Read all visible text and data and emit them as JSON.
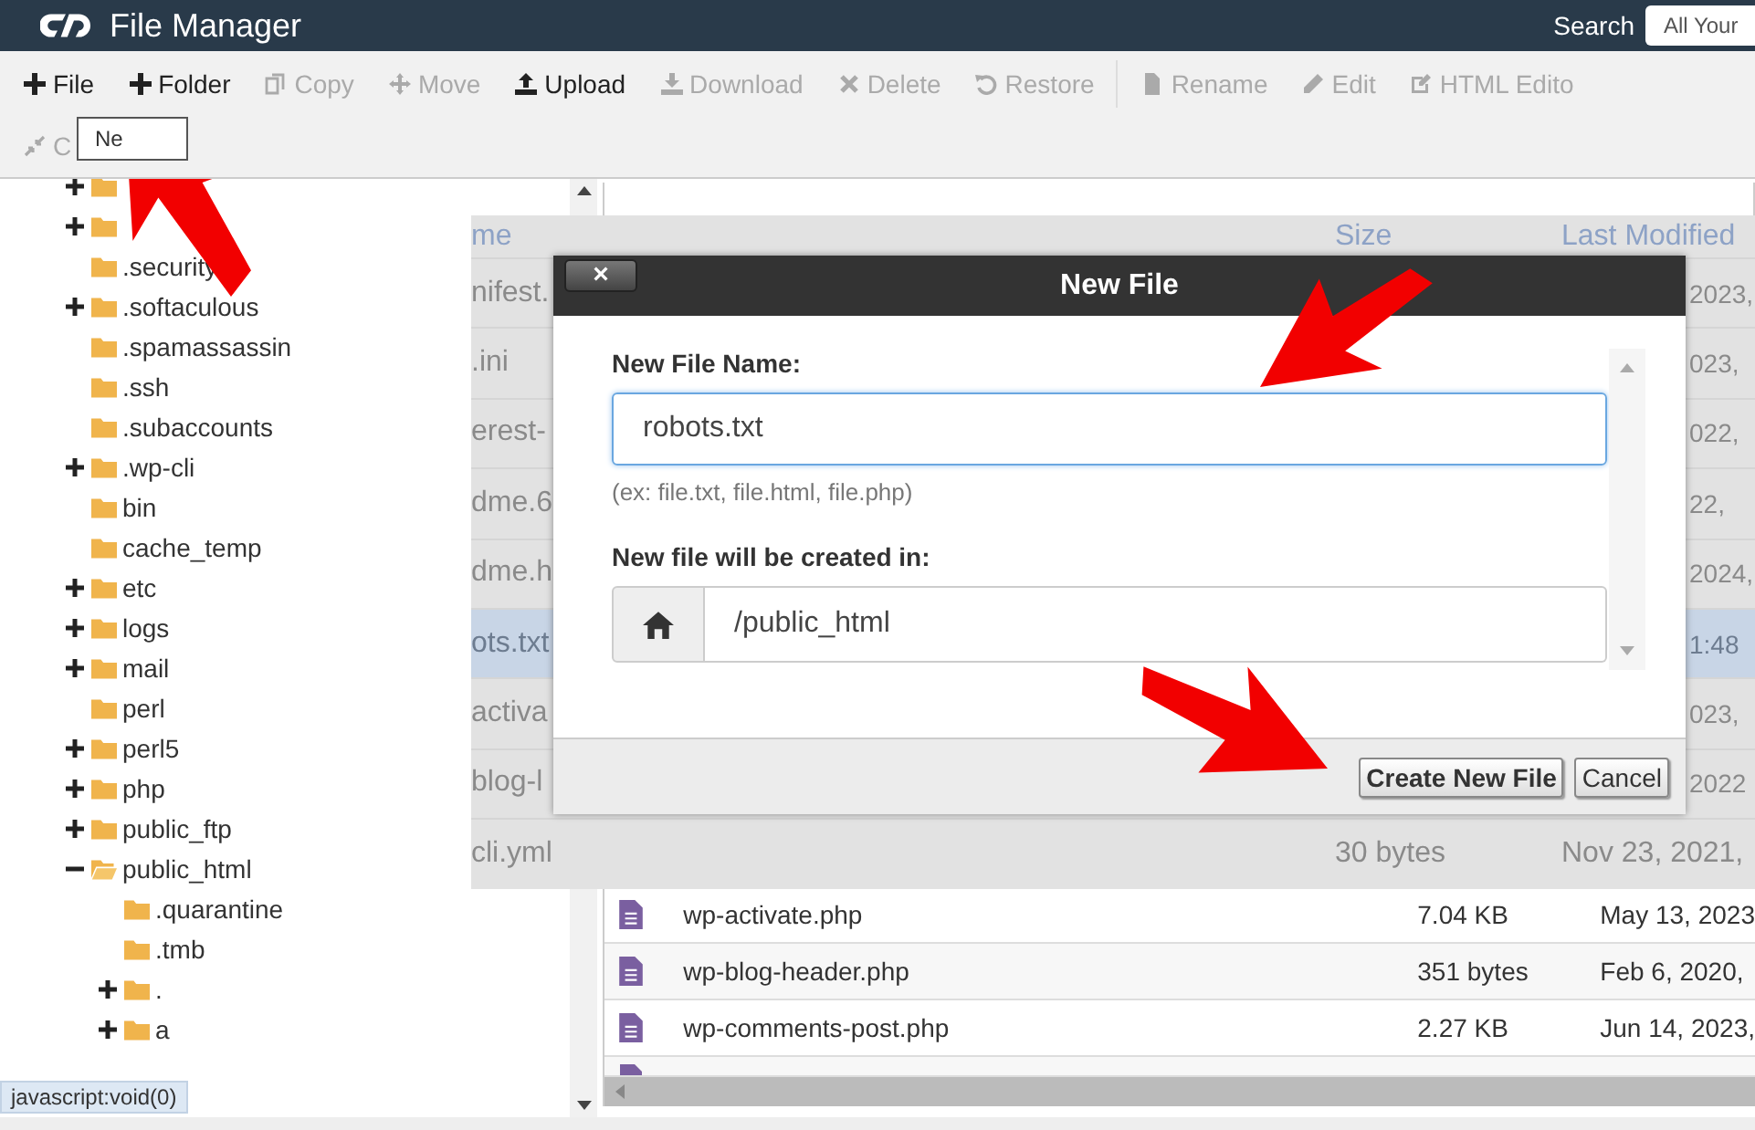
{
  "header": {
    "title": "File Manager",
    "search_label": "Search",
    "search_value": "All Your"
  },
  "toolbar": [
    {
      "label": "File",
      "disabled": false
    },
    {
      "label": "Folder",
      "disabled": false
    },
    {
      "label": "Copy",
      "disabled": true
    },
    {
      "label": "Move",
      "disabled": true
    },
    {
      "label": "Upload",
      "disabled": false
    },
    {
      "label": "Download",
      "disabled": true
    },
    {
      "label": "Delete",
      "disabled": true
    },
    {
      "label": "Restore",
      "disabled": true
    },
    {
      "label": "Rename",
      "disabled": true
    },
    {
      "label": "Edit",
      "disabled": true
    },
    {
      "label": "HTML Edito",
      "disabled": true
    }
  ],
  "toolbar_row2": [
    {
      "label": "C",
      "disabled": true
    }
  ],
  "tooltip": "Ne",
  "tree": [
    {
      "expanded": false
    },
    {
      "expanded": false
    },
    {
      "label": ".security"
    },
    {
      "label": ".softaculous",
      "expanded": false
    },
    {
      "label": ".spamassassin"
    },
    {
      "label": ".ssh"
    },
    {
      "label": ".subaccounts"
    },
    {
      "label": ".wp-cli",
      "expanded": false
    },
    {
      "label": "bin"
    },
    {
      "label": "cache_temp"
    },
    {
      "label": "etc",
      "expanded": false
    },
    {
      "label": "logs",
      "expanded": false
    },
    {
      "label": "mail",
      "expanded": false
    },
    {
      "label": "perl"
    },
    {
      "label": "perl5",
      "expanded": false
    },
    {
      "label": "php",
      "expanded": false
    },
    {
      "label": "public_ftp",
      "expanded": false
    },
    {
      "label": "public_html",
      "expanded": true,
      "children": [
        {
          "label": ".quarantine"
        },
        {
          "label": ".tmb"
        },
        {
          "label": ".",
          "expanded": false
        },
        {
          "label": "a",
          "expanded": false
        }
      ]
    }
  ],
  "status_link": "javascript:void(0)",
  "backdrop": {
    "columns": [
      "me",
      "Size",
      "Last Modified"
    ],
    "rows": [
      {
        "name": "nifest.",
        "date": "2023,",
        "selected": false
      },
      {
        "name": ".ini",
        "date": "023,",
        "selected": false
      },
      {
        "name": "erest-",
        "date": "022,",
        "selected": false
      },
      {
        "name": "dme.6",
        "date": "22,",
        "selected": false
      },
      {
        "name": "dme.h",
        "date": "2024,",
        "selected": false
      },
      {
        "name": "ots.txt",
        "date": "1:48",
        "selected": true
      },
      {
        "name": "activa",
        "date": "023,",
        "selected": false
      },
      {
        "name": "blog-l",
        "date": "2022",
        "selected": false
      },
      {
        "name": "cli.yml",
        "size": "30 bytes",
        "date": "Nov 23, 2021,",
        "selected": false
      }
    ]
  },
  "files": [
    {
      "name": "wp-activate.php",
      "size": "7.04 KB",
      "date": "May 13, 2023"
    },
    {
      "name": "wp-blog-header.php",
      "size": "351 bytes",
      "date": "Feb 6, 2020,"
    },
    {
      "name": "wp-comments-post.php",
      "size": "2.27 KB",
      "date": "Jun 14, 2023,"
    }
  ],
  "dialog": {
    "title": "New File",
    "close": "×",
    "name_label": "New File Name:",
    "name_value": "robots.txt",
    "hint": "(ex: file.txt, file.html, file.php)",
    "dir_label": "New file will be created in:",
    "dir_value": "/public_html",
    "buttons": [
      {
        "label": "Create New File",
        "kind": "primary"
      },
      {
        "label": "Cancel",
        "kind": "secondary"
      }
    ]
  }
}
